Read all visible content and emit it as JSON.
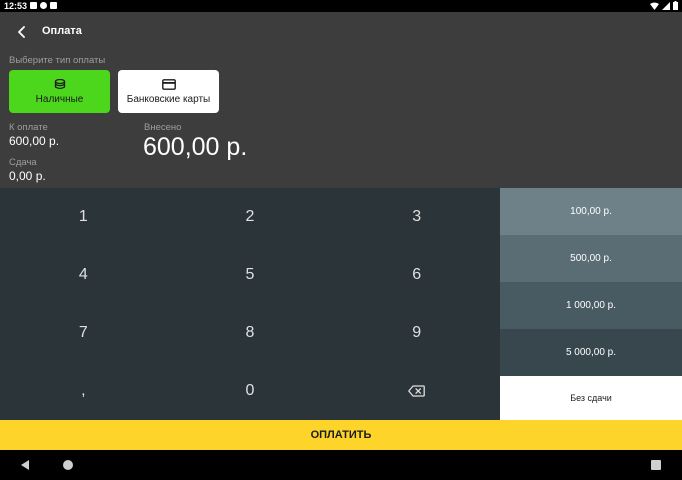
{
  "status": {
    "time": "12:53"
  },
  "header": {
    "title": "Оплата"
  },
  "payment_type": {
    "prompt": "Выберите тип оплаты",
    "cash_label": "Наличные",
    "card_label": "Банковские карты"
  },
  "summary": {
    "due_label": "К оплате",
    "due_value": "600,00 р.",
    "change_label": "Сдача",
    "change_value": "0,00 р.",
    "paid_label": "Внесено",
    "paid_value": "600,00 р."
  },
  "keypad": {
    "k1": "1",
    "k2": "2",
    "k3": "3",
    "k4": "4",
    "k5": "5",
    "k6": "6",
    "k7": "7",
    "k8": "8",
    "k9": "9",
    "comma": ",",
    "k0": "0"
  },
  "amounts": {
    "a1": "100,00 р.",
    "a2": "500,00 р.",
    "a3": "1 000,00 р.",
    "a4": "5 000,00 р.",
    "no_change": "Без сдачи"
  },
  "footer": {
    "pay_label": "ОПЛАТИТЬ"
  },
  "colors": {
    "cash_accent": "#4cd61c",
    "pay_button": "#fdd42a",
    "keypad_bg": "#2b3438",
    "header_bg": "#3d3d3d"
  }
}
